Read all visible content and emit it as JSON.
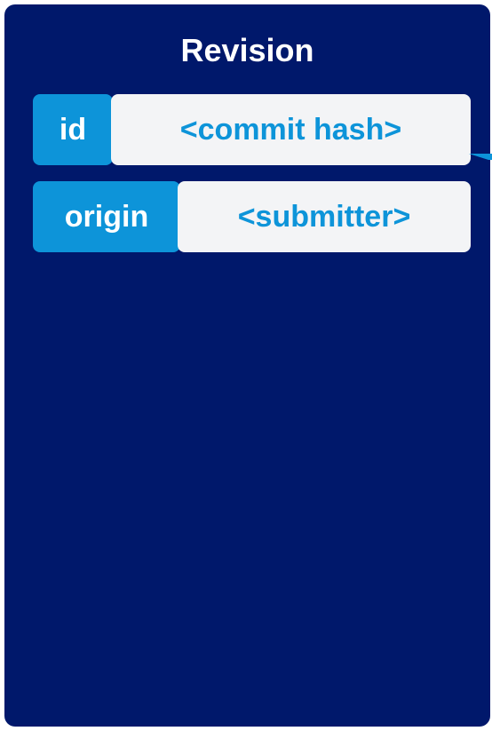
{
  "card": {
    "title": "Revision",
    "fields": [
      {
        "key": "id",
        "value": "<commit hash>"
      },
      {
        "key": "origin",
        "value": "<submitter>"
      }
    ]
  },
  "colors": {
    "card_background": "#00186b",
    "key_background": "#0d94d9",
    "value_background": "#f3f4f6",
    "value_text": "#0d94d9",
    "title_text": "#ffffff"
  }
}
